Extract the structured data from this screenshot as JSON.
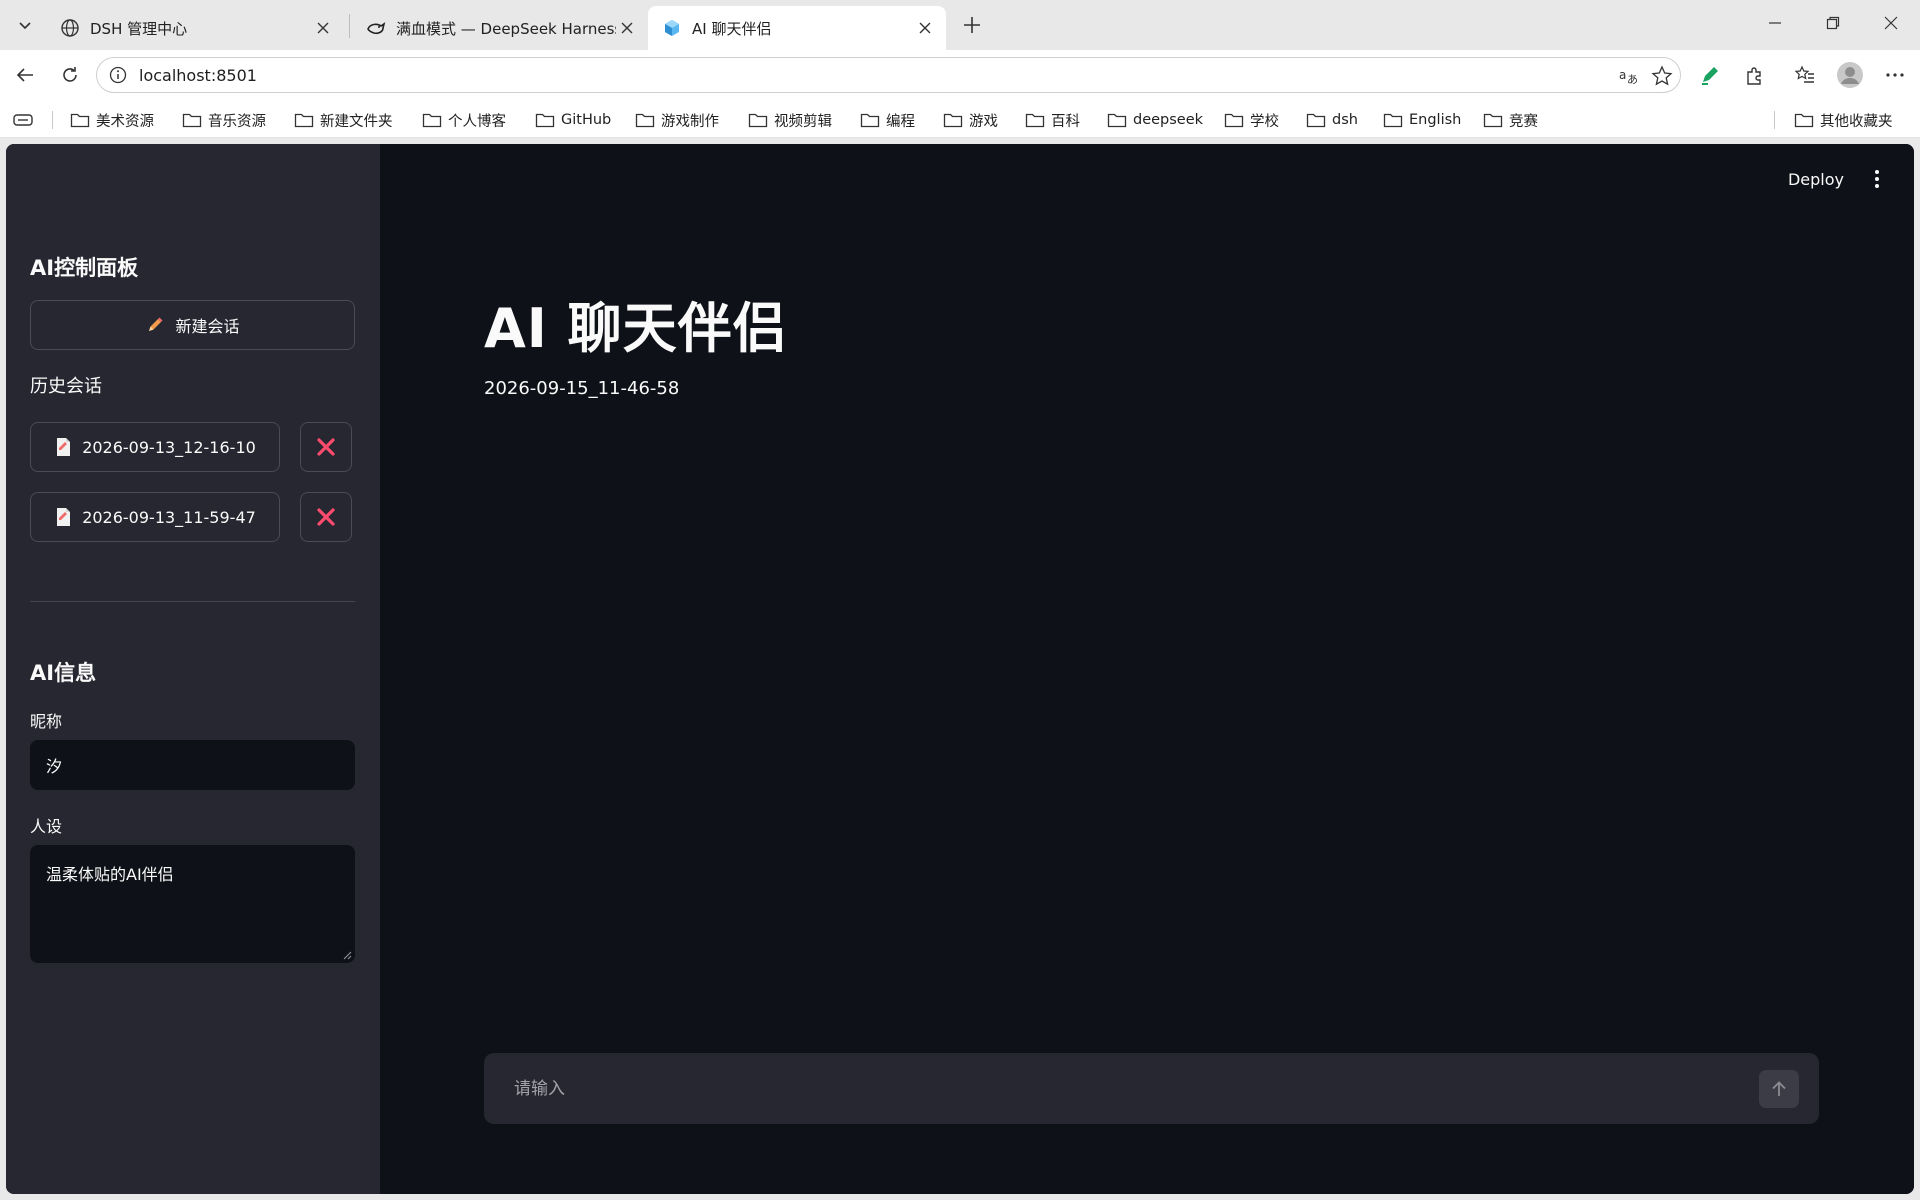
{
  "browser": {
    "tabs": [
      {
        "title": "DSH 管理中心",
        "icon": "globe-icon",
        "active": false
      },
      {
        "title": "满血模式 — DeepSeek Harness",
        "icon": "deepseek-whale-icon",
        "active": false
      },
      {
        "title": "AI 聊天伴侣",
        "icon": "streamlit-cube-icon",
        "active": true
      }
    ],
    "address": "localhost:8501",
    "bookmarks": [
      "美术资源",
      "音乐资源",
      "新建文件夹",
      "个人博客",
      "GitHub",
      "游戏制作",
      "视频剪辑",
      "编程",
      "游戏",
      "百科",
      "deepseek",
      "学校",
      "dsh",
      "English",
      "竞赛"
    ],
    "other_bookmarks": "其他收藏夹"
  },
  "app": {
    "deploy_label": "Deploy",
    "sidebar": {
      "panel_title": "AI控制面板",
      "new_chat_label": "新建会话",
      "history_title": "历史会话",
      "history": [
        {
          "label": "2026-09-13_12-16-10"
        },
        {
          "label": "2026-09-13_11-59-47"
        }
      ],
      "info_title": "AI信息",
      "nickname_label": "昵称",
      "nickname_value": "汐",
      "persona_label": "人设",
      "persona_value": "温柔体贴的AI伴侣"
    },
    "main": {
      "title": "AI 聊天伴侣",
      "session_id": "2026-09-15_11-46-58",
      "chat_placeholder": "请输入"
    }
  },
  "colors": {
    "sidebar_bg": "#262730",
    "main_bg": "#0e1117",
    "delete_red": "#ff4b6e",
    "edge_green": "#1aa260"
  }
}
